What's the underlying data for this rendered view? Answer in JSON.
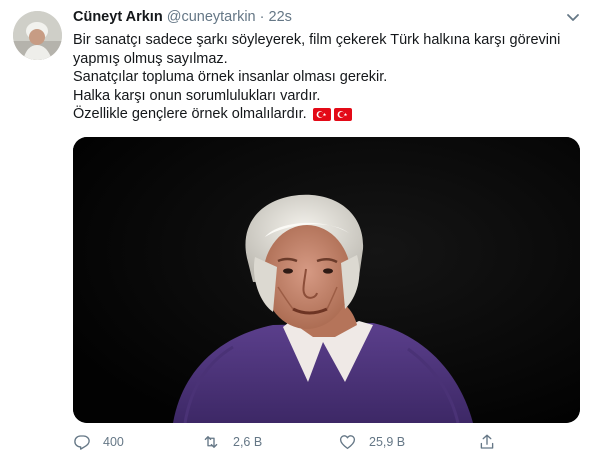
{
  "tweet": {
    "author_name": "Cüneyt Arkın",
    "handle": "@cuneytarkin",
    "separator": "·",
    "time": "22s",
    "lines": [
      "Bir sanatçı sadece şarkı söyleyerek, film çekerek Türk halkına karşı görevini",
      "yapmış olmuş sayılmaz.",
      "Sanatçılar topluma örnek insanlar olması gerekir.",
      "Halka karşı onun sorumlulukları vardır.",
      "Özellikle gençlere örnek olmalılardır."
    ],
    "emoji": [
      "turkey-flag-icon",
      "turkey-flag-icon"
    ]
  },
  "actions": {
    "reply_count": "400",
    "retweet_count": "2,6 B",
    "like_count": "25,9 B"
  },
  "icons": [
    "reply-icon",
    "retweet-icon",
    "like-icon",
    "share-icon",
    "chevron-down-icon"
  ],
  "colors": {
    "text": "#14171a",
    "secondary": "#657786",
    "flag_red": "#e30a17"
  }
}
